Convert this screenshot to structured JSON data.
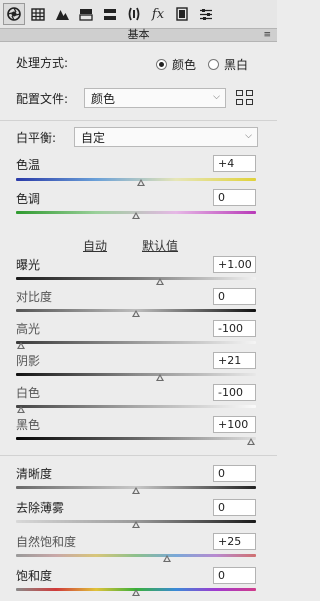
{
  "toolbar": {
    "icons": [
      {
        "name": "aperture-icon",
        "glyph": "⚙",
        "active": true
      },
      {
        "name": "grid-icon",
        "glyph": "▦",
        "active": false
      },
      {
        "name": "mountain-icon",
        "glyph": "▲",
        "active": false
      },
      {
        "name": "split-toning-icon",
        "glyph": "▤",
        "active": false
      },
      {
        "name": "detail-icon",
        "glyph": "▬",
        "active": false
      },
      {
        "name": "lens-icon",
        "glyph": "⊂⊃",
        "active": false
      },
      {
        "name": "fx-icon",
        "glyph": "fx",
        "active": false
      },
      {
        "name": "camera-calibration-icon",
        "glyph": "▮",
        "active": false
      },
      {
        "name": "presets-icon",
        "glyph": "≡",
        "active": false
      }
    ]
  },
  "panel": {
    "title": "基本",
    "menu_icon": "≡"
  },
  "treatment": {
    "label": "处理方式:",
    "options": [
      {
        "label": "颜色",
        "selected": true
      },
      {
        "label": "黑白",
        "selected": false
      }
    ]
  },
  "profile": {
    "label": "配置文件:",
    "value": "颜色"
  },
  "white_balance": {
    "label": "白平衡:",
    "value": "自定"
  },
  "auto_label": "自动",
  "default_label": "默认值",
  "sliders": {
    "temperature": {
      "label": "色温",
      "value": "+4",
      "level": 0.52
    },
    "tint": {
      "label": "色调",
      "value": "0",
      "level": 0.5
    },
    "exposure": {
      "label": "曝光",
      "value": "+1.00",
      "level": 0.6
    },
    "contrast": {
      "label": "对比度",
      "value": "0",
      "level": 0.5
    },
    "highlights": {
      "label": "高光",
      "value": "-100",
      "level": 0.0
    },
    "shadows": {
      "label": "阴影",
      "value": "+21",
      "level": 0.6
    },
    "whites": {
      "label": "白色",
      "value": "-100",
      "level": 0.0
    },
    "blacks": {
      "label": "黑色",
      "value": "+100",
      "level": 1.0
    },
    "clarity": {
      "label": "清晰度",
      "value": "0",
      "level": 0.5
    },
    "dehaze": {
      "label": "去除薄雾",
      "value": "0",
      "level": 0.5
    },
    "vibrance": {
      "label": "自然饱和度",
      "value": "+25",
      "level": 0.63
    },
    "saturation": {
      "label": "饱和度",
      "value": "0",
      "level": 0.5
    }
  }
}
